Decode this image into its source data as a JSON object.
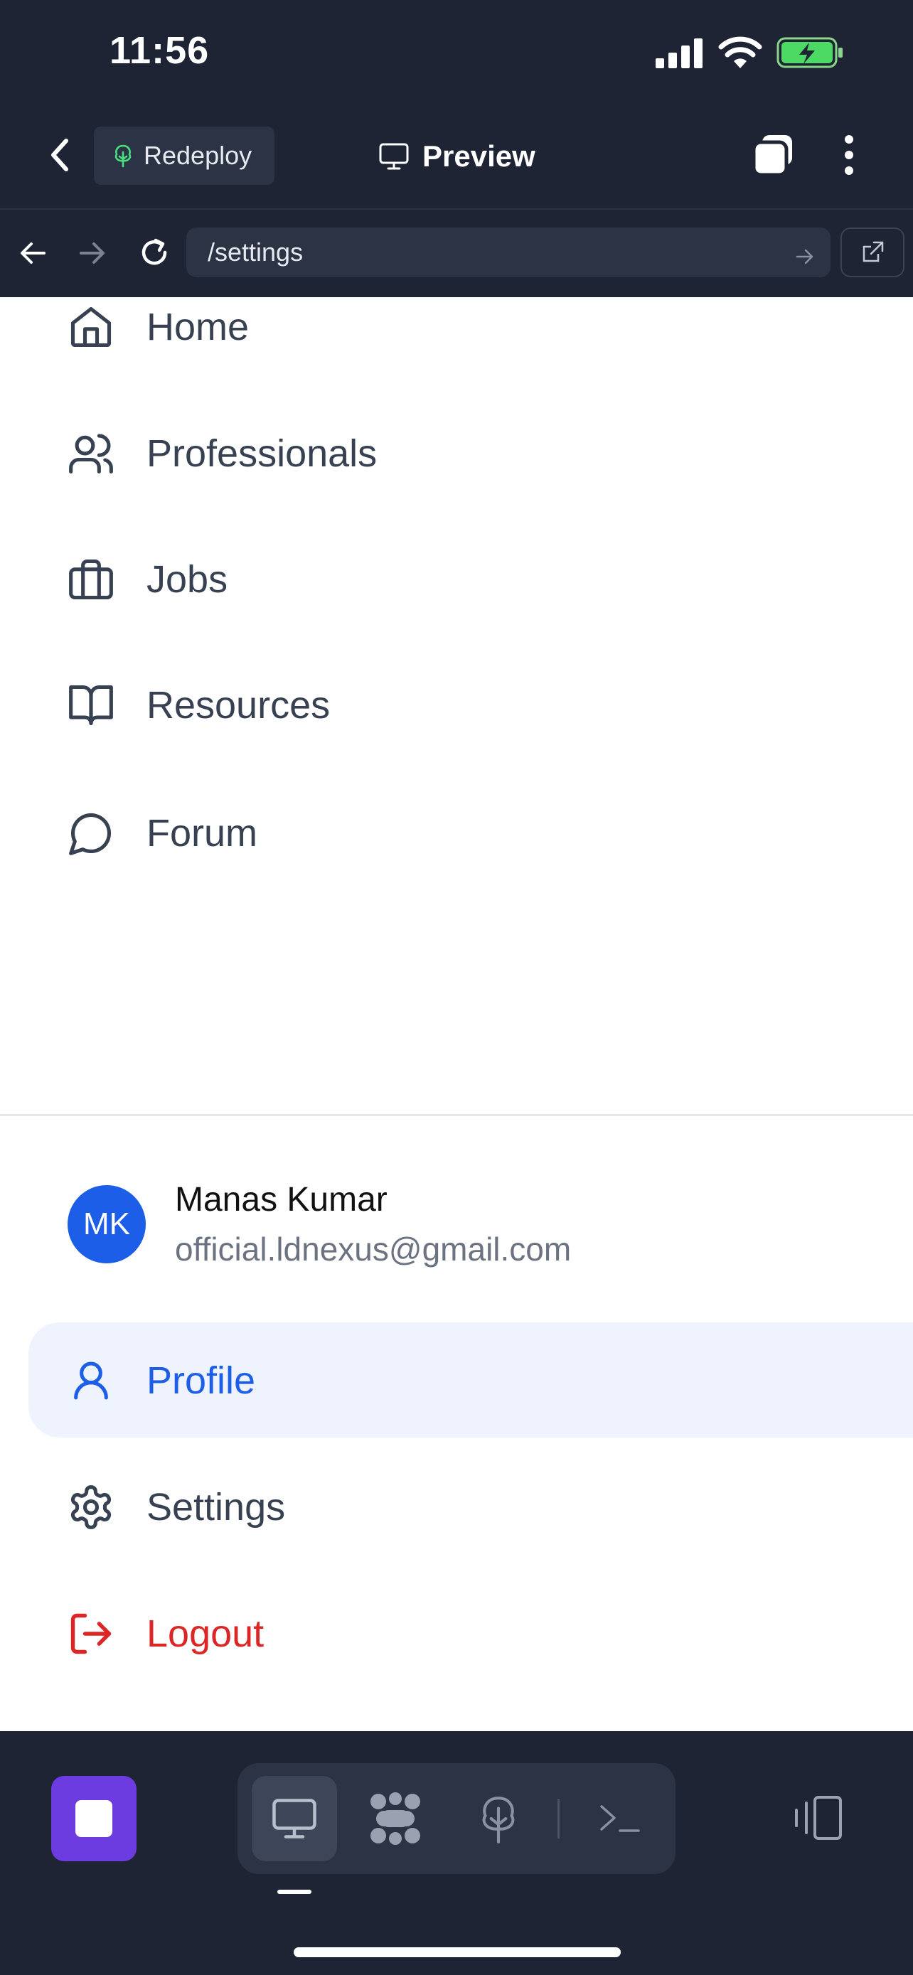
{
  "status": {
    "time": "11:56"
  },
  "toolbar": {
    "redeploy_label": "Redeploy",
    "preview_label": "Preview"
  },
  "browser": {
    "url": "/settings"
  },
  "menu": {
    "items": [
      {
        "label": "Home"
      },
      {
        "label": "Professionals"
      },
      {
        "label": "Jobs"
      },
      {
        "label": "Resources"
      },
      {
        "label": "Forum"
      }
    ]
  },
  "user": {
    "initials": "MK",
    "name": "Manas Kumar",
    "email": "official.ldnexus@gmail.com"
  },
  "account_menu": {
    "profile": "Profile",
    "settings": "Settings",
    "logout": "Logout"
  },
  "colors": {
    "accent": "#1d5ee8",
    "danger": "#dc2626",
    "stop": "#6d3ce0",
    "dark": "#1e2433"
  }
}
